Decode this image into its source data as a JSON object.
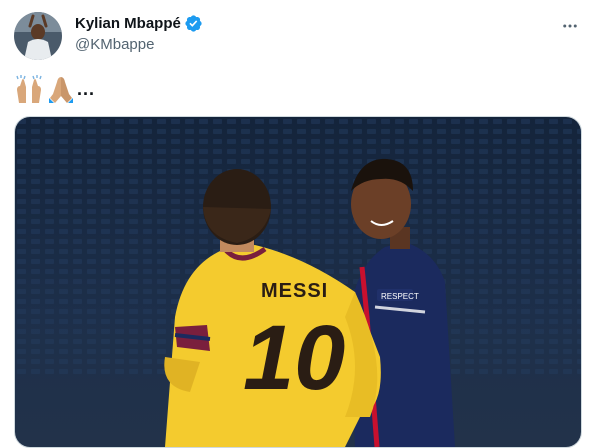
{
  "tweet": {
    "author": {
      "display_name": "Kylian Mbappé",
      "handle": "@KMbappe",
      "verified": true,
      "avatar_icon": "profile-photo"
    },
    "text": {
      "emojis": [
        "raising-hands-emoji",
        "folded-hands-emoji"
      ],
      "ellipsis": "..."
    },
    "more_icon": "more-horizontal-icon",
    "media": {
      "jersey_left_name": "MESSI",
      "jersey_left_number": "10",
      "sleeve_badge": "RESPECT"
    }
  },
  "colors": {
    "verified_blue": "#1d9bf0",
    "handle_gray": "#536471",
    "barca_yellow": "#f4cb2e",
    "psg_navy": "#1b2a5e",
    "stadium_blue": "#1a2a42"
  }
}
